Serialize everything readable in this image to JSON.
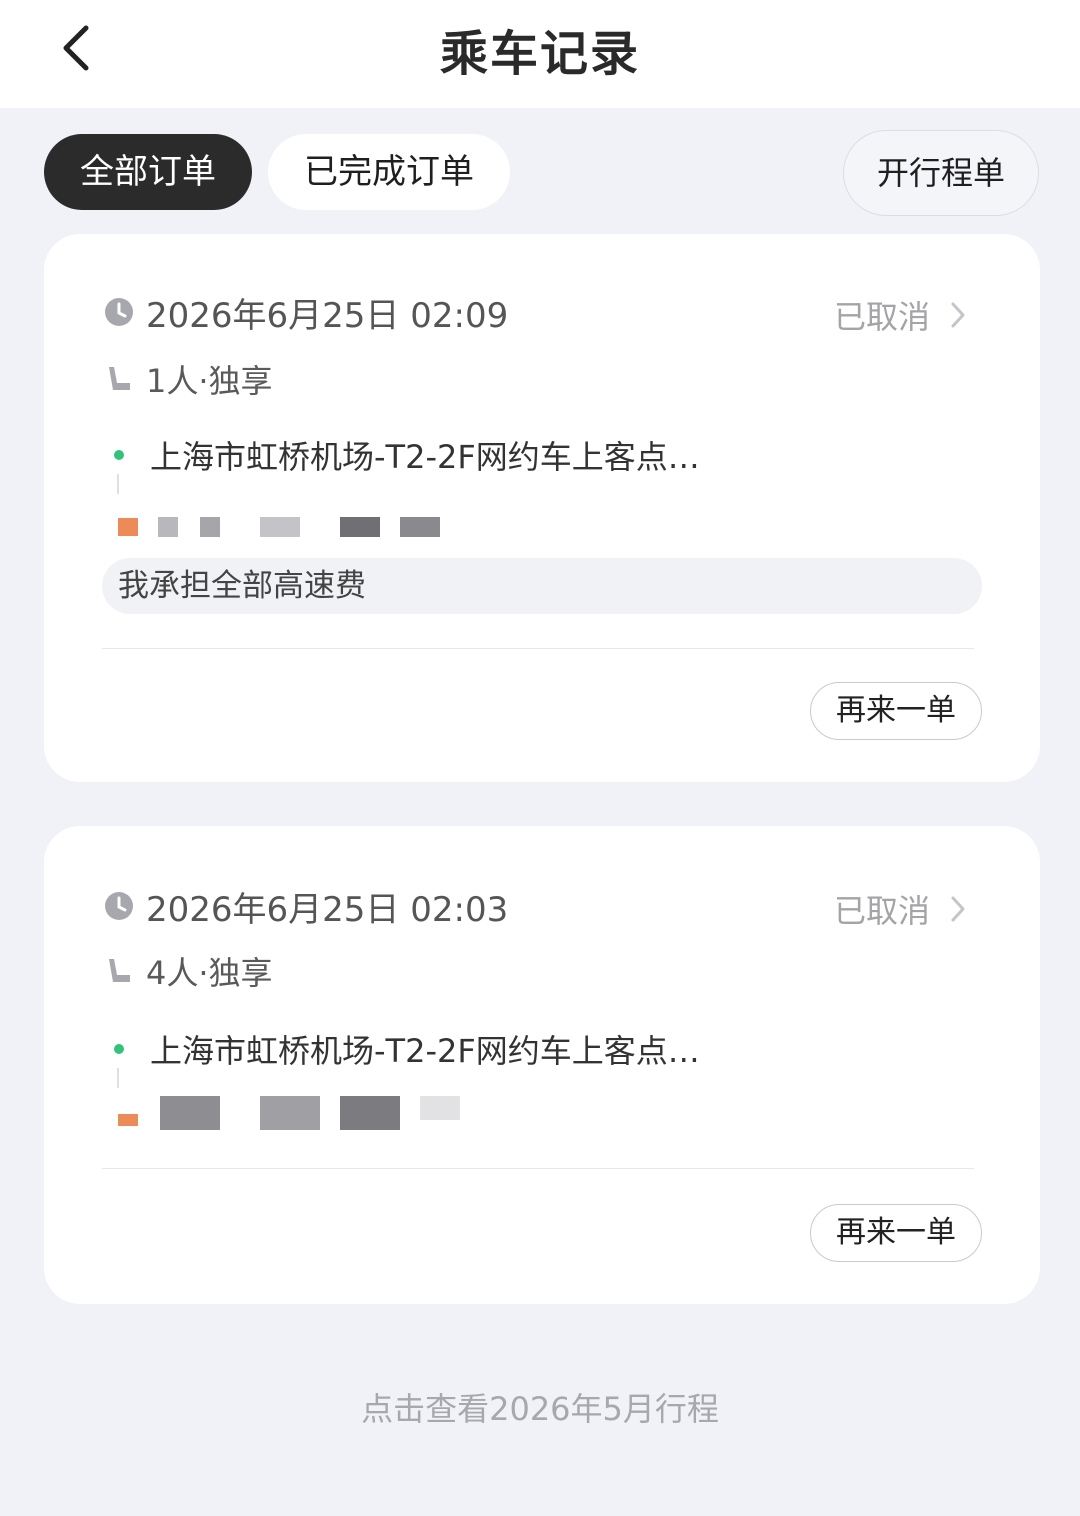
{
  "header": {
    "title": "乘车记录"
  },
  "tabs": [
    {
      "label": "全部订单",
      "active": true
    },
    {
      "label": "已完成订单",
      "active": false
    }
  ],
  "actions": {
    "itinerary_label": "开行程单"
  },
  "orders": [
    {
      "time": "2026年6月25日 02:09",
      "status": "已取消",
      "seats": "1人·独享",
      "pickup": "上海市虹桥机场-T2-2F网约车上客点…",
      "note": "我承担全部高速费",
      "reorder_label": "再来一单"
    },
    {
      "time": "2026年6月25日 02:03",
      "status": "已取消",
      "seats": "4人·独享",
      "pickup": "上海市虹桥机场-T2-2F网约车上客点…",
      "reorder_label": "再来一单"
    }
  ],
  "footer": {
    "history_link": "点击查看2026年5月行程"
  },
  "colors": {
    "active_tab": "#2b2b2b",
    "pickup_dot": "#33c27b",
    "dropoff_marker": "#ec8a58",
    "status_text": "#a3a3a8",
    "background": "#f1f2f7"
  },
  "icons": [
    "back-arrow-icon",
    "clock-icon",
    "seat-icon",
    "chevron-right-icon"
  ]
}
